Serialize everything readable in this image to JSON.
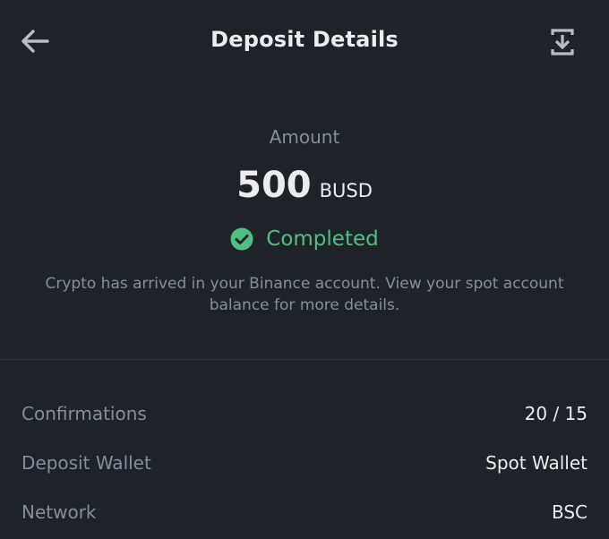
{
  "header": {
    "title": "Deposit Details",
    "back_icon": "arrow-left-icon",
    "share_icon": "share-export-icon"
  },
  "amount": {
    "label": "Amount",
    "value": "500",
    "unit": "BUSD"
  },
  "status": {
    "icon": "check-circle-icon",
    "text": "Completed",
    "color": "#51bf82"
  },
  "message": "Crypto has arrived in your Binance account. View your spot account balance for more details.",
  "details": [
    {
      "label": "Confirmations",
      "value": "20 / 15"
    },
    {
      "label": "Deposit Wallet",
      "value": "Spot Wallet"
    },
    {
      "label": "Network",
      "value": "BSC"
    }
  ],
  "colors": {
    "background": "#1e2329",
    "primary_text": "#eaecef",
    "secondary_text": "#848e9c",
    "success": "#51bf82"
  }
}
